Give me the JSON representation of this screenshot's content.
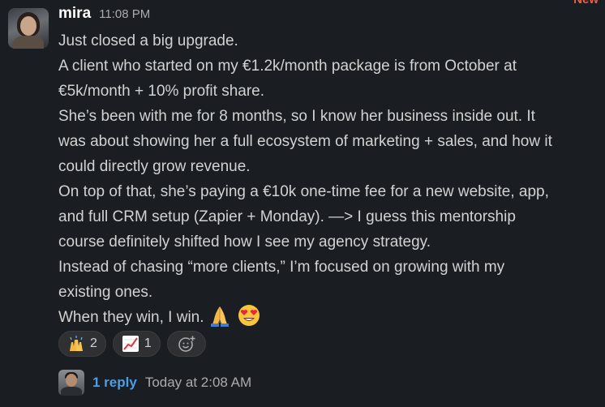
{
  "badge": {
    "new": "New"
  },
  "message": {
    "author": "mira",
    "time": "11:08 PM",
    "lines": [
      "Just closed a big upgrade.",
      "A client who started on my €1.2k/month package is from October at",
      "€5k/month + 10% profit share.",
      "She’s been with me for 8 months, so I know her business inside out.  It",
      "was about showing her a full ecosystem of marketing + sales, and how it",
      "could directly grow revenue.",
      "On top of that, she’s paying a €10k one-time fee for a new website, app,",
      "and full CRM setup (Zapier + Monday). —> I guess this mentorship",
      "course definitely shifted how I see my agency strategy.",
      "Instead of chasing “more clients,” I’m focused on growing with my",
      "existing ones.",
      "When they win, I win."
    ],
    "trailing_emojis": [
      "folded-hands",
      "smiling-face-with-heart-eyes"
    ]
  },
  "reactions": [
    {
      "emoji": "raising-hands",
      "count": "2"
    },
    {
      "emoji": "chart-increasing",
      "count": "1"
    }
  ],
  "add_reaction_icon": "add-reaction-icon",
  "thread": {
    "reply_label": "1 reply",
    "last_reply": "Today at 2:08 AM"
  },
  "colors": {
    "background": "#1a1d21",
    "text": "#d1d2d3",
    "link": "#4a9fe8",
    "new_badge": "#e8604c"
  }
}
